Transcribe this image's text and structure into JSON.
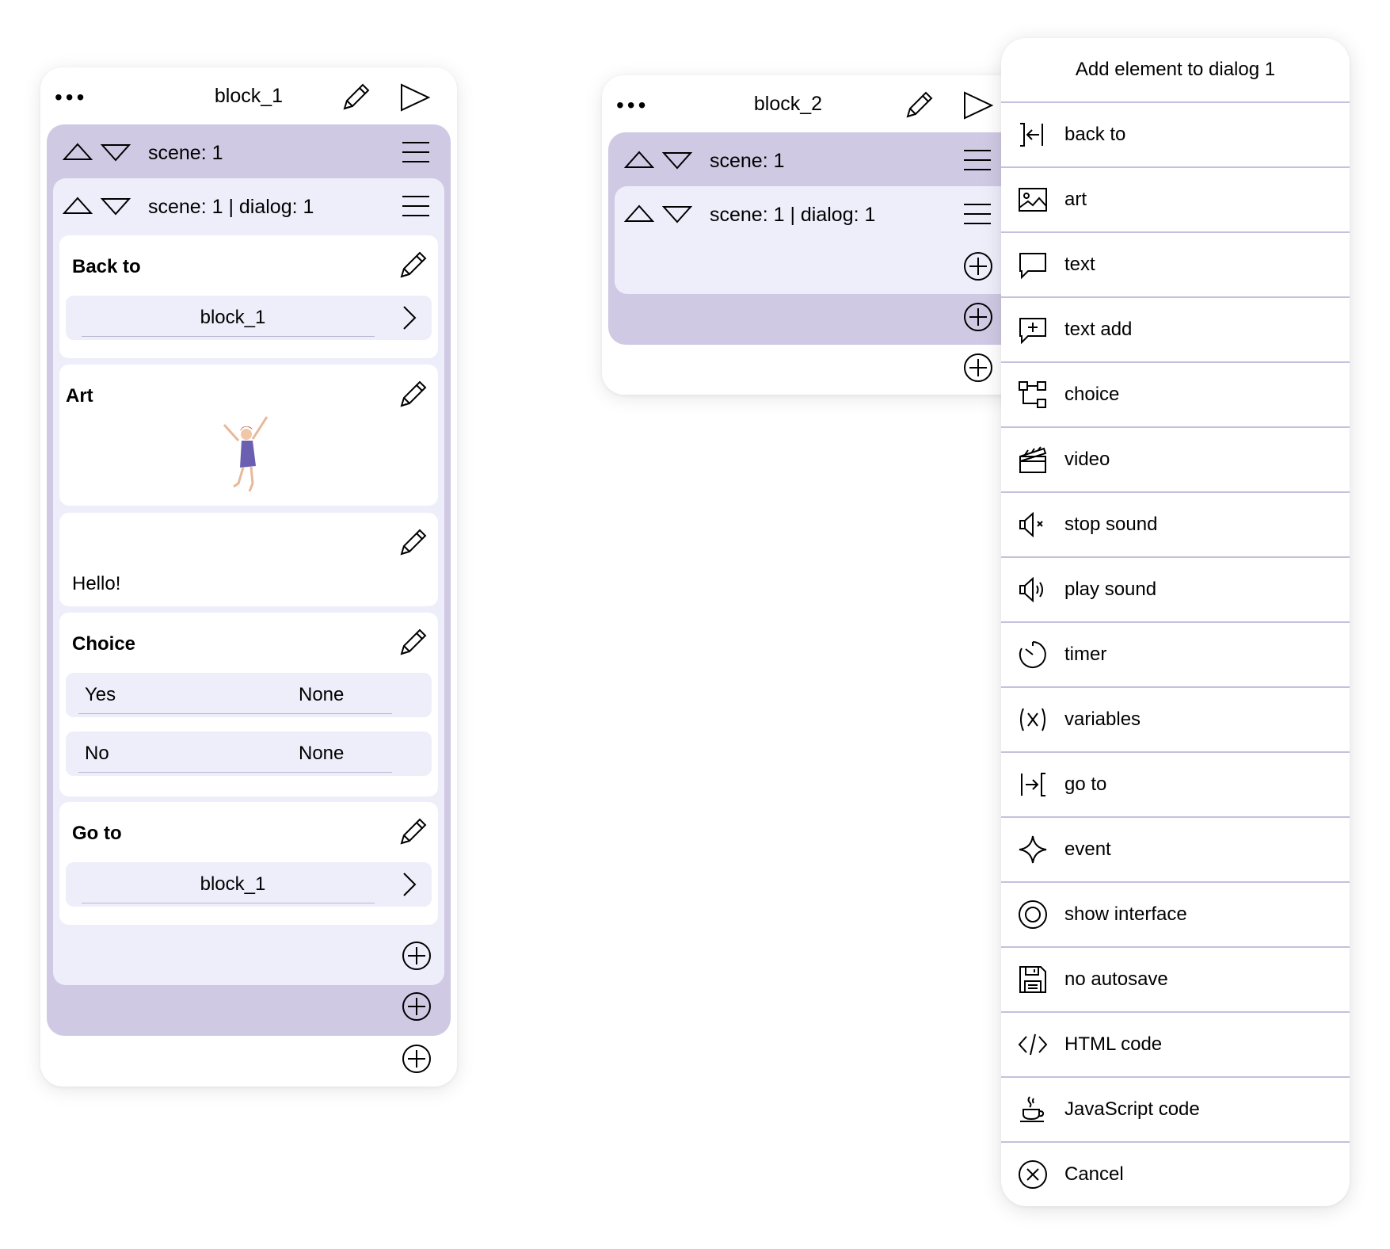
{
  "block1": {
    "menu_dots": "•••",
    "title": "block_1",
    "scene_label": "scene: 1",
    "dialog_label": "scene: 1 | dialog: 1",
    "back_to": {
      "title": "Back to",
      "target": "block_1"
    },
    "art": {
      "title": "Art",
      "image": "dancing-girl-art"
    },
    "text": {
      "body": "Hello!"
    },
    "choice": {
      "title": "Choice",
      "options": [
        {
          "label": "Yes",
          "target": "None"
        },
        {
          "label": "No",
          "target": "None"
        }
      ]
    },
    "go_to": {
      "title": "Go to",
      "target": "block_1"
    }
  },
  "block2": {
    "menu_dots": "•••",
    "title": "block_2",
    "scene_label": "scene: 1",
    "dialog_label": "scene: 1 | dialog: 1"
  },
  "add_menu": {
    "title": "Add element to dialog 1",
    "items": [
      {
        "label": "back to",
        "icon": "back-to-icon"
      },
      {
        "label": "art",
        "icon": "image-icon"
      },
      {
        "label": "text",
        "icon": "speech-bubble-icon"
      },
      {
        "label": "text add",
        "icon": "speech-bubble-plus-icon"
      },
      {
        "label": "choice",
        "icon": "branch-icon"
      },
      {
        "label": "video",
        "icon": "clapperboard-icon"
      },
      {
        "label": "stop sound",
        "icon": "speaker-mute-icon"
      },
      {
        "label": "play sound",
        "icon": "speaker-icon"
      },
      {
        "label": "timer",
        "icon": "timer-icon"
      },
      {
        "label": "variables",
        "icon": "variables-icon"
      },
      {
        "label": "go to",
        "icon": "go-to-icon"
      },
      {
        "label": "event",
        "icon": "sparkle-icon"
      },
      {
        "label": "show interface",
        "icon": "circle-target-icon"
      },
      {
        "label": "no autosave",
        "icon": "floppy-disk-icon"
      },
      {
        "label": "HTML code",
        "icon": "code-icon"
      },
      {
        "label": "JavaScript code",
        "icon": "coffee-cup-icon"
      },
      {
        "label": "Cancel",
        "icon": "cancel-circle-icon"
      }
    ]
  },
  "colors": {
    "scene_bg": "#cfc9e3",
    "dialog_bg": "#eeeefb",
    "divider": "#c5c0dd"
  }
}
